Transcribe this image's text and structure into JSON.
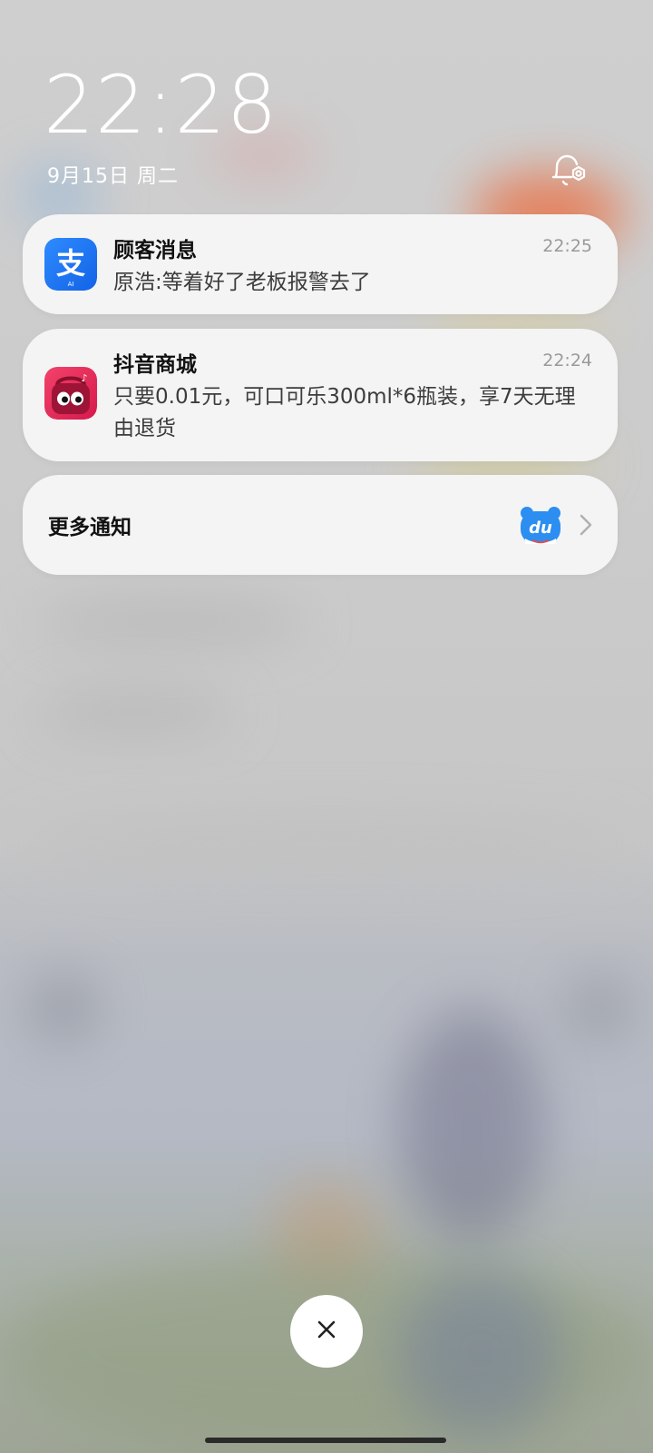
{
  "lockscreen": {
    "time": "22:28",
    "date": "9月15日 周二"
  },
  "notifications": [
    {
      "app_icon": "alipay-icon",
      "title": "顾客消息",
      "time": "22:25",
      "body": "原浩:等着好了老板报警去了",
      "icon_color": "#1677ff"
    },
    {
      "app_icon": "douyin-mall-icon",
      "title": "抖音商城",
      "time": "22:24",
      "body": "只要0.01元，可口可乐300ml*6瓶装，享7天无理由退货",
      "icon_color": "#e8255a"
    }
  ],
  "more_notifications": {
    "label": "更多通知",
    "app_icon": "baidu-du-icon",
    "icon_color": "#2b8ef0"
  },
  "controls": {
    "close_icon": "close-icon"
  },
  "colors": {
    "card_bg": "#f4f4f4",
    "title_text": "#111111",
    "body_text": "#3c3c3c",
    "time_text": "#9a9a9a"
  }
}
